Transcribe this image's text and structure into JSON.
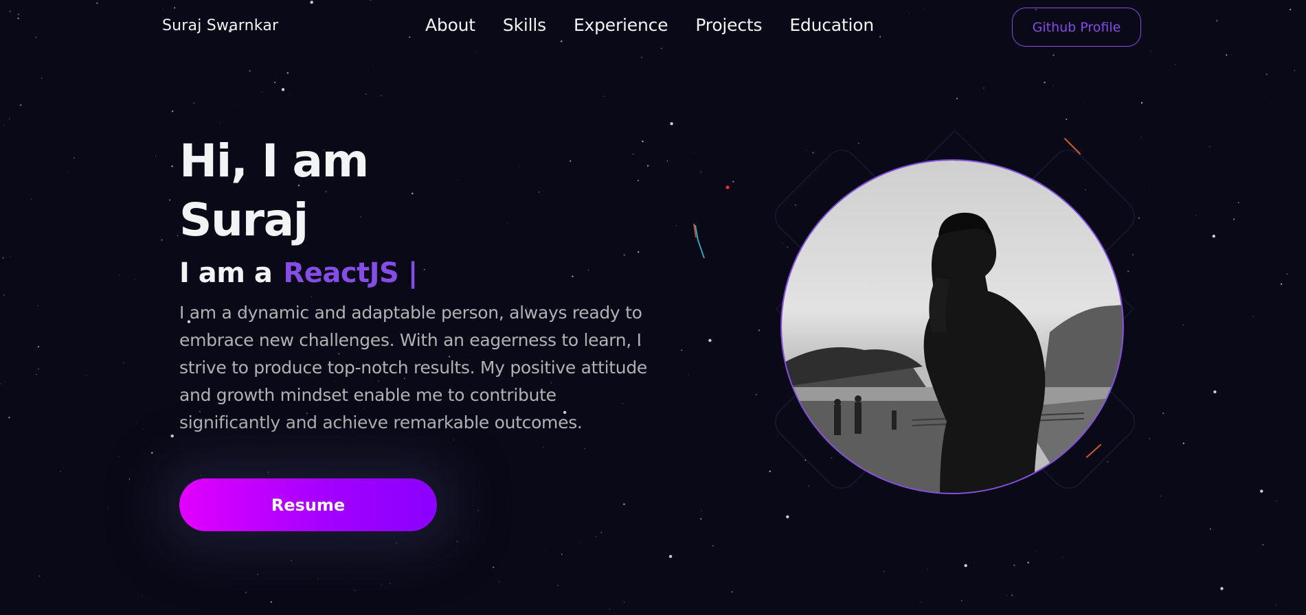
{
  "nav": {
    "brand": "Suraj Swarnkar",
    "links": [
      "About",
      "Skills",
      "Experience",
      "Projects",
      "Education"
    ],
    "github_label": "Github Profile"
  },
  "hero": {
    "title_line1": "Hi, I am",
    "title_line2": "Suraj",
    "role_prefix": "I am a",
    "role_typed": "ReactJS |",
    "description": "I am a dynamic and adaptable person, always ready to embrace new challenges. With an eagerness to learn, I strive to produce top-notch results. My positive attitude and growth mindset enable me to contribute significantly and achieve remarkable outcomes.",
    "resume_label": "Resume",
    "profile_image_alt": "profile-photo"
  },
  "colors": {
    "background": "#090917",
    "accent": "#854ce6",
    "text_primary": "#f2f3f4",
    "text_secondary": "#b1b2b3",
    "button_gradient_start": "#e100ff",
    "button_gradient_end": "#8a00ff"
  }
}
